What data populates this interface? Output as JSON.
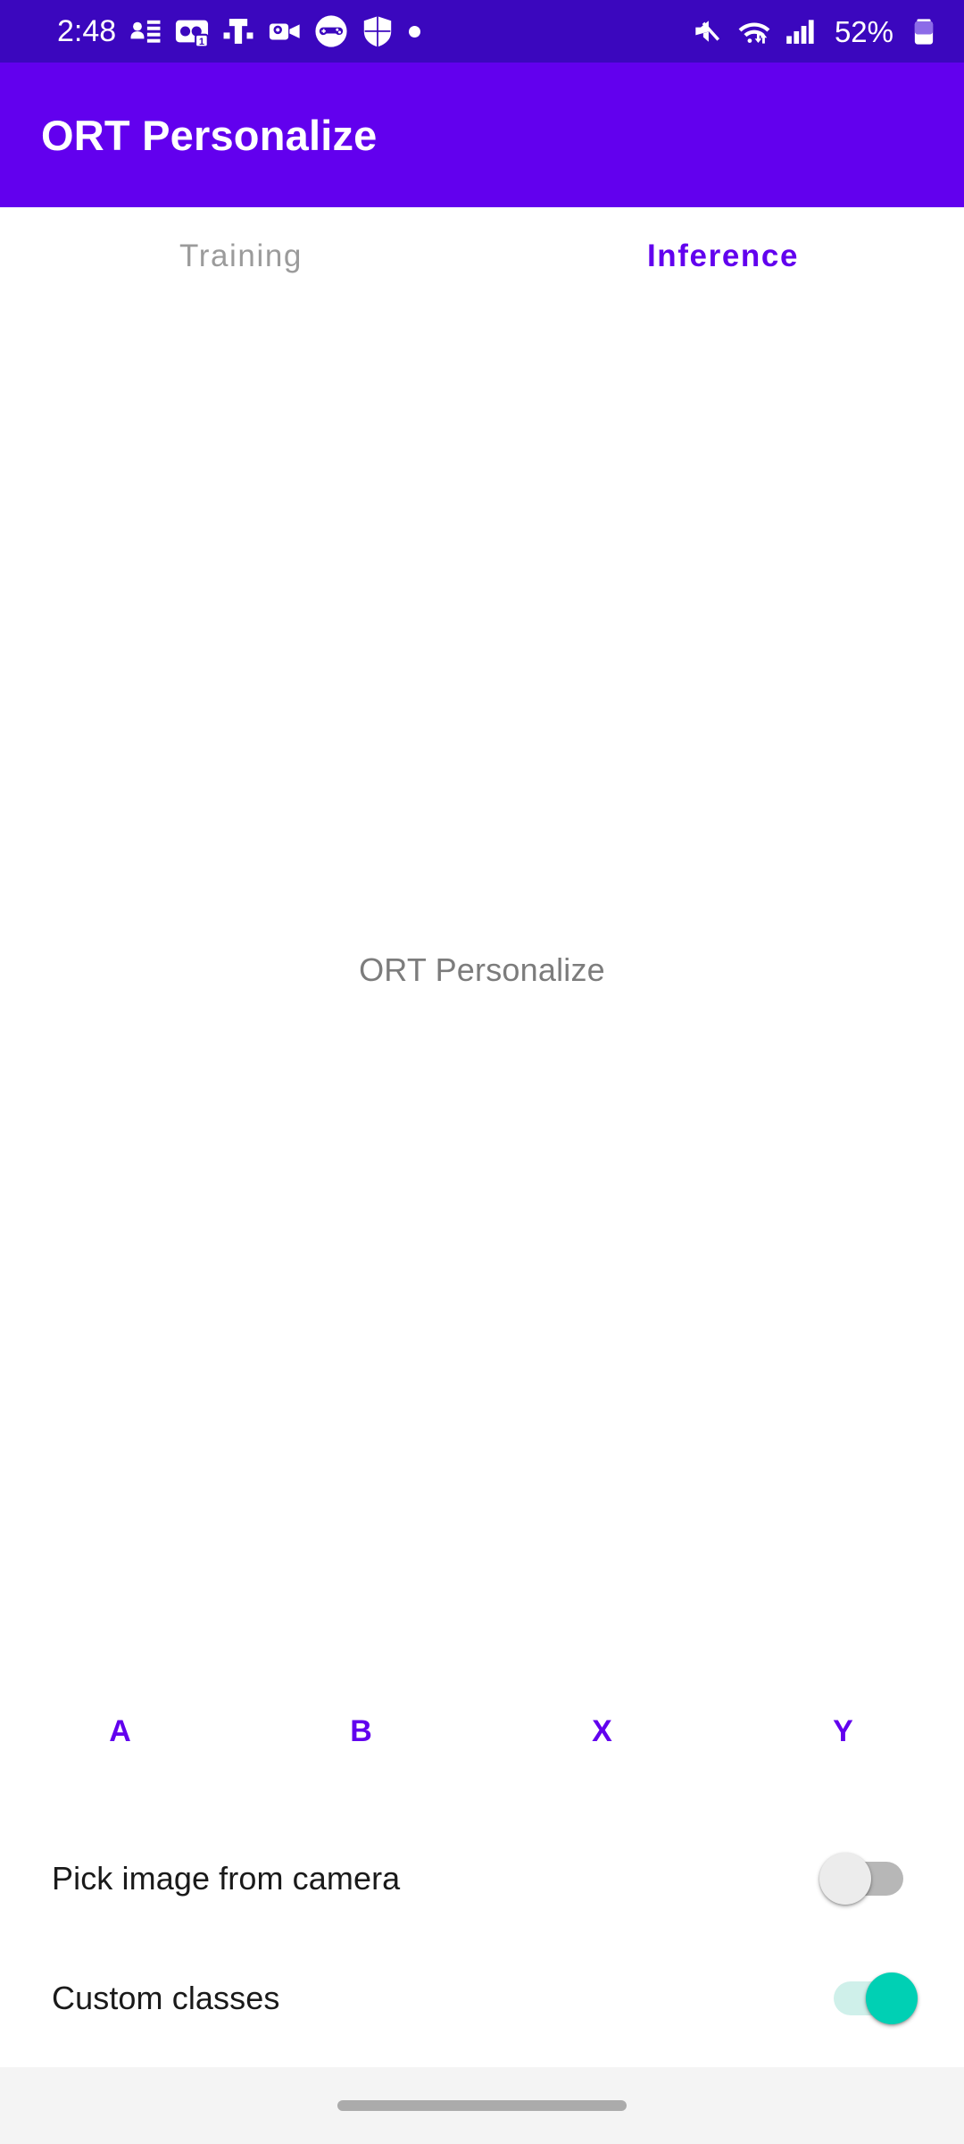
{
  "status_bar": {
    "clock": "2:48",
    "battery_percent": "52%",
    "background_color": "#3B07BE",
    "notification_icons": [
      "contacts-card-icon",
      "voicemail-icon",
      "t-mobile-icon",
      "outlook-video-icon",
      "game-controller-icon",
      "windows-security-shield-icon",
      "notification-dot-icon"
    ],
    "system_icons": [
      "volume-mute-icon",
      "wifi-transfer-icon",
      "cellular-signal-icon",
      "battery-icon"
    ]
  },
  "app_bar": {
    "title": "ORT Personalize",
    "background_color": "#6200EE",
    "title_color": "#FFFFFF"
  },
  "tabs": {
    "active_color": "#6200EE",
    "inactive_color": "#9B9B9B",
    "items": [
      {
        "label": "Training",
        "active": false
      },
      {
        "label": "Inference",
        "active": true
      }
    ]
  },
  "content": {
    "image_placeholder_label": "ORT Personalize",
    "image_placeholder_color": "#7C7C7C",
    "class_buttons": [
      {
        "label": "A"
      },
      {
        "label": "B"
      },
      {
        "label": "X"
      },
      {
        "label": "Y"
      }
    ],
    "class_button_color": "#6200EE",
    "switches": [
      {
        "label": "Pick image from camera",
        "state": "off",
        "thumb_color": "#ECECEC",
        "track_color": "#B7B7B7"
      },
      {
        "label": "Custom classes",
        "state": "on",
        "thumb_color": "#00D0B4",
        "track_color": "#CFF0EA"
      }
    ]
  },
  "nav_bar": {
    "gesture_pill": "gesture-pill",
    "background_color": "#F4F4F4",
    "pill_color": "#ABABAB"
  }
}
